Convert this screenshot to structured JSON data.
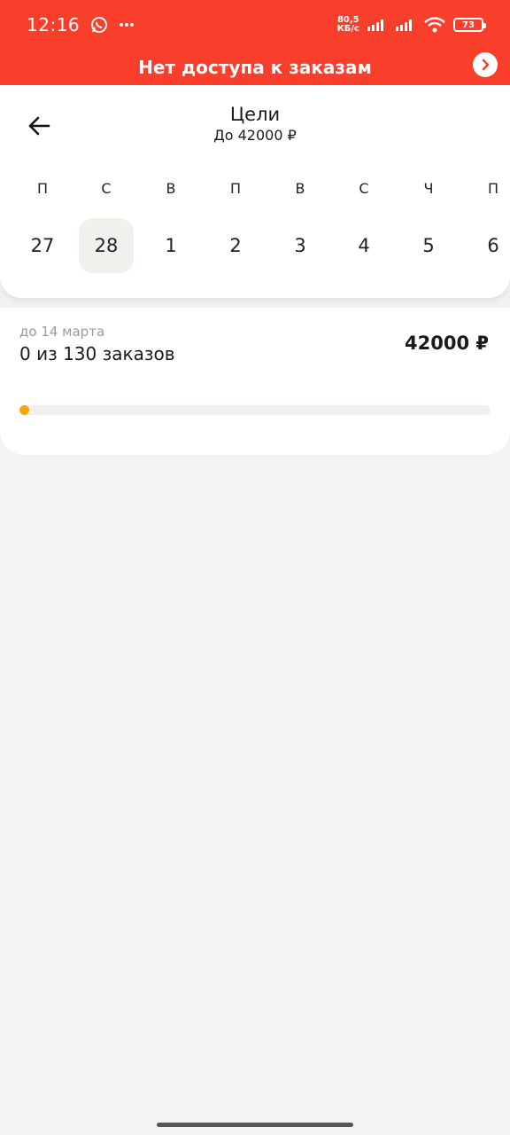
{
  "status_bar": {
    "time": "12:16",
    "net_speed_value": "80,5",
    "net_speed_unit": "КБ/с",
    "battery": "73"
  },
  "banner": {
    "title": "Нет доступа к заказам"
  },
  "header": {
    "title": "Цели",
    "subtitle": "До 42000 ₽"
  },
  "calendar": {
    "weekdays": [
      "П",
      "С",
      "В",
      "П",
      "В",
      "С",
      "Ч",
      "П"
    ],
    "dates": [
      "27",
      "28",
      "1",
      "2",
      "3",
      "4",
      "5",
      "6"
    ],
    "selected_index": 1
  },
  "goal": {
    "deadline": "до 14 марта",
    "progress_text": "0 из 130 заказов",
    "amount": "42000 ₽",
    "progress_fraction": 0,
    "progress_color": "#f5a800"
  },
  "colors": {
    "accent": "#fa3e2c",
    "progress": "#f5a800"
  }
}
